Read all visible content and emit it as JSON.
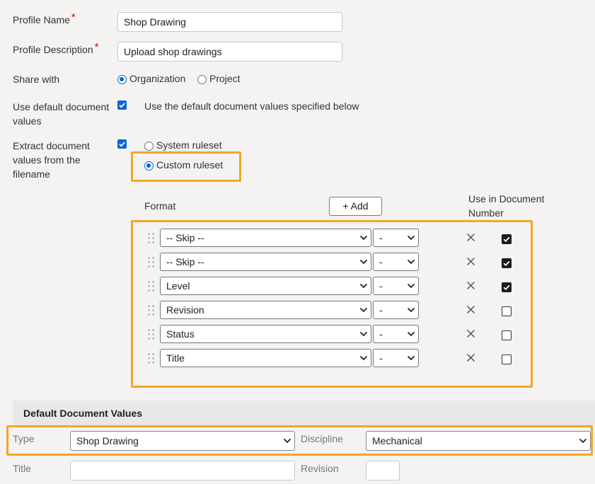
{
  "form": {
    "profile_name_label": "Profile Name",
    "profile_name_value": "Shop Drawing",
    "profile_desc_label": "Profile Description",
    "profile_desc_value": "Upload shop drawings",
    "required_mark": "*",
    "share_label": "Share with",
    "share_options": [
      "Organization",
      "Project"
    ],
    "share_selected": "Organization",
    "use_default_label_1": "Use default document",
    "use_default_label_2": "values",
    "use_default_text": "Use the default document values specified below",
    "extract_label_1": "Extract document",
    "extract_label_2": "values from the",
    "extract_label_3": "filename",
    "ruleset_options": [
      "System ruleset",
      "Custom ruleset"
    ],
    "ruleset_selected": "Custom ruleset"
  },
  "format": {
    "header_format": "Format",
    "add_button": "+ Add",
    "header_use_1": "Use in Document",
    "header_use_2": "Number",
    "rows": [
      {
        "field": "-- Skip --",
        "separator": "-",
        "use": true
      },
      {
        "field": "-- Skip --",
        "separator": "-",
        "use": true
      },
      {
        "field": "Level",
        "separator": "-",
        "use": true
      },
      {
        "field": "Revision",
        "separator": "-",
        "use": false
      },
      {
        "field": "Status",
        "separator": "-",
        "use": false
      },
      {
        "field": "Title",
        "separator": "-",
        "use": false
      }
    ]
  },
  "defaults": {
    "section_title": "Default Document Values",
    "type_label": "Type",
    "type_value": "Shop Drawing",
    "discipline_label": "Discipline",
    "discipline_value": "Mechanical",
    "title_label": "Title",
    "title_value": "",
    "revision_label": "Revision",
    "revision_value": ""
  },
  "colors": {
    "accent": "#0a64d6",
    "highlight": "#f5a623",
    "required": "#d40000"
  }
}
